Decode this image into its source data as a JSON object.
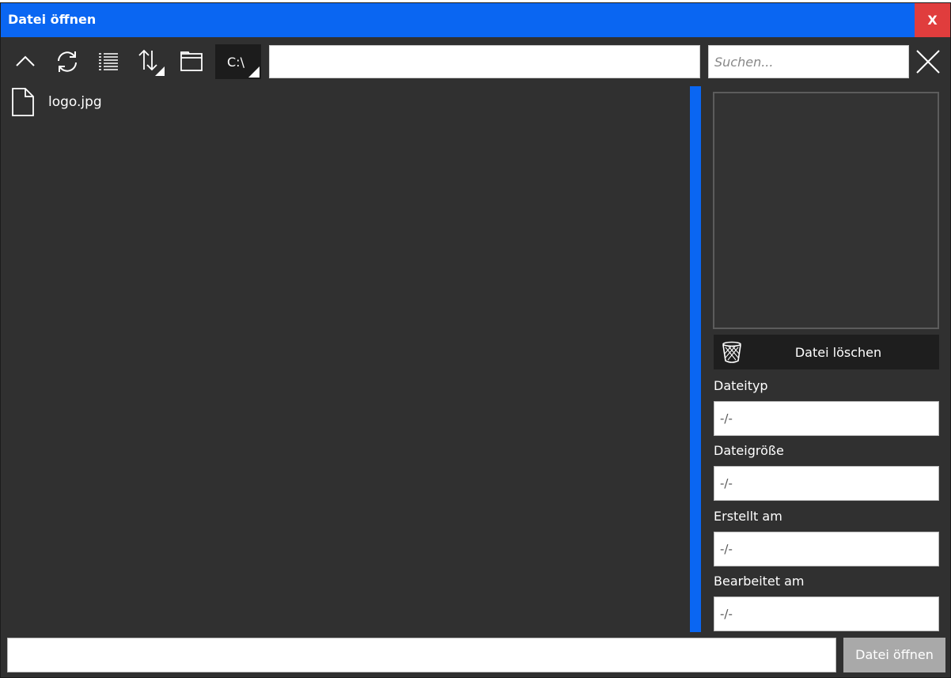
{
  "window": {
    "title": "Datei öffnen",
    "close_label": "X"
  },
  "toolbar": {
    "drive_label": "C:\\",
    "path_value": "",
    "search_placeholder": "Suchen..."
  },
  "files": [
    {
      "name": "logo.jpg",
      "icon": "file-icon"
    }
  ],
  "details": {
    "delete_label": "Datei löschen",
    "properties": [
      {
        "label": "Dateityp",
        "value": "-/-"
      },
      {
        "label": "Dateigröße",
        "value": "-/-"
      },
      {
        "label": "Erstellt am",
        "value": "-/-"
      },
      {
        "label": "Bearbeitet am",
        "value": "-/-"
      }
    ]
  },
  "footer": {
    "filename_value": "",
    "open_label": "Datei öffnen"
  },
  "colors": {
    "accent": "#0a66f2",
    "close": "#e03d3d",
    "background": "#303030",
    "disabled_button": "#a9a9a9"
  }
}
